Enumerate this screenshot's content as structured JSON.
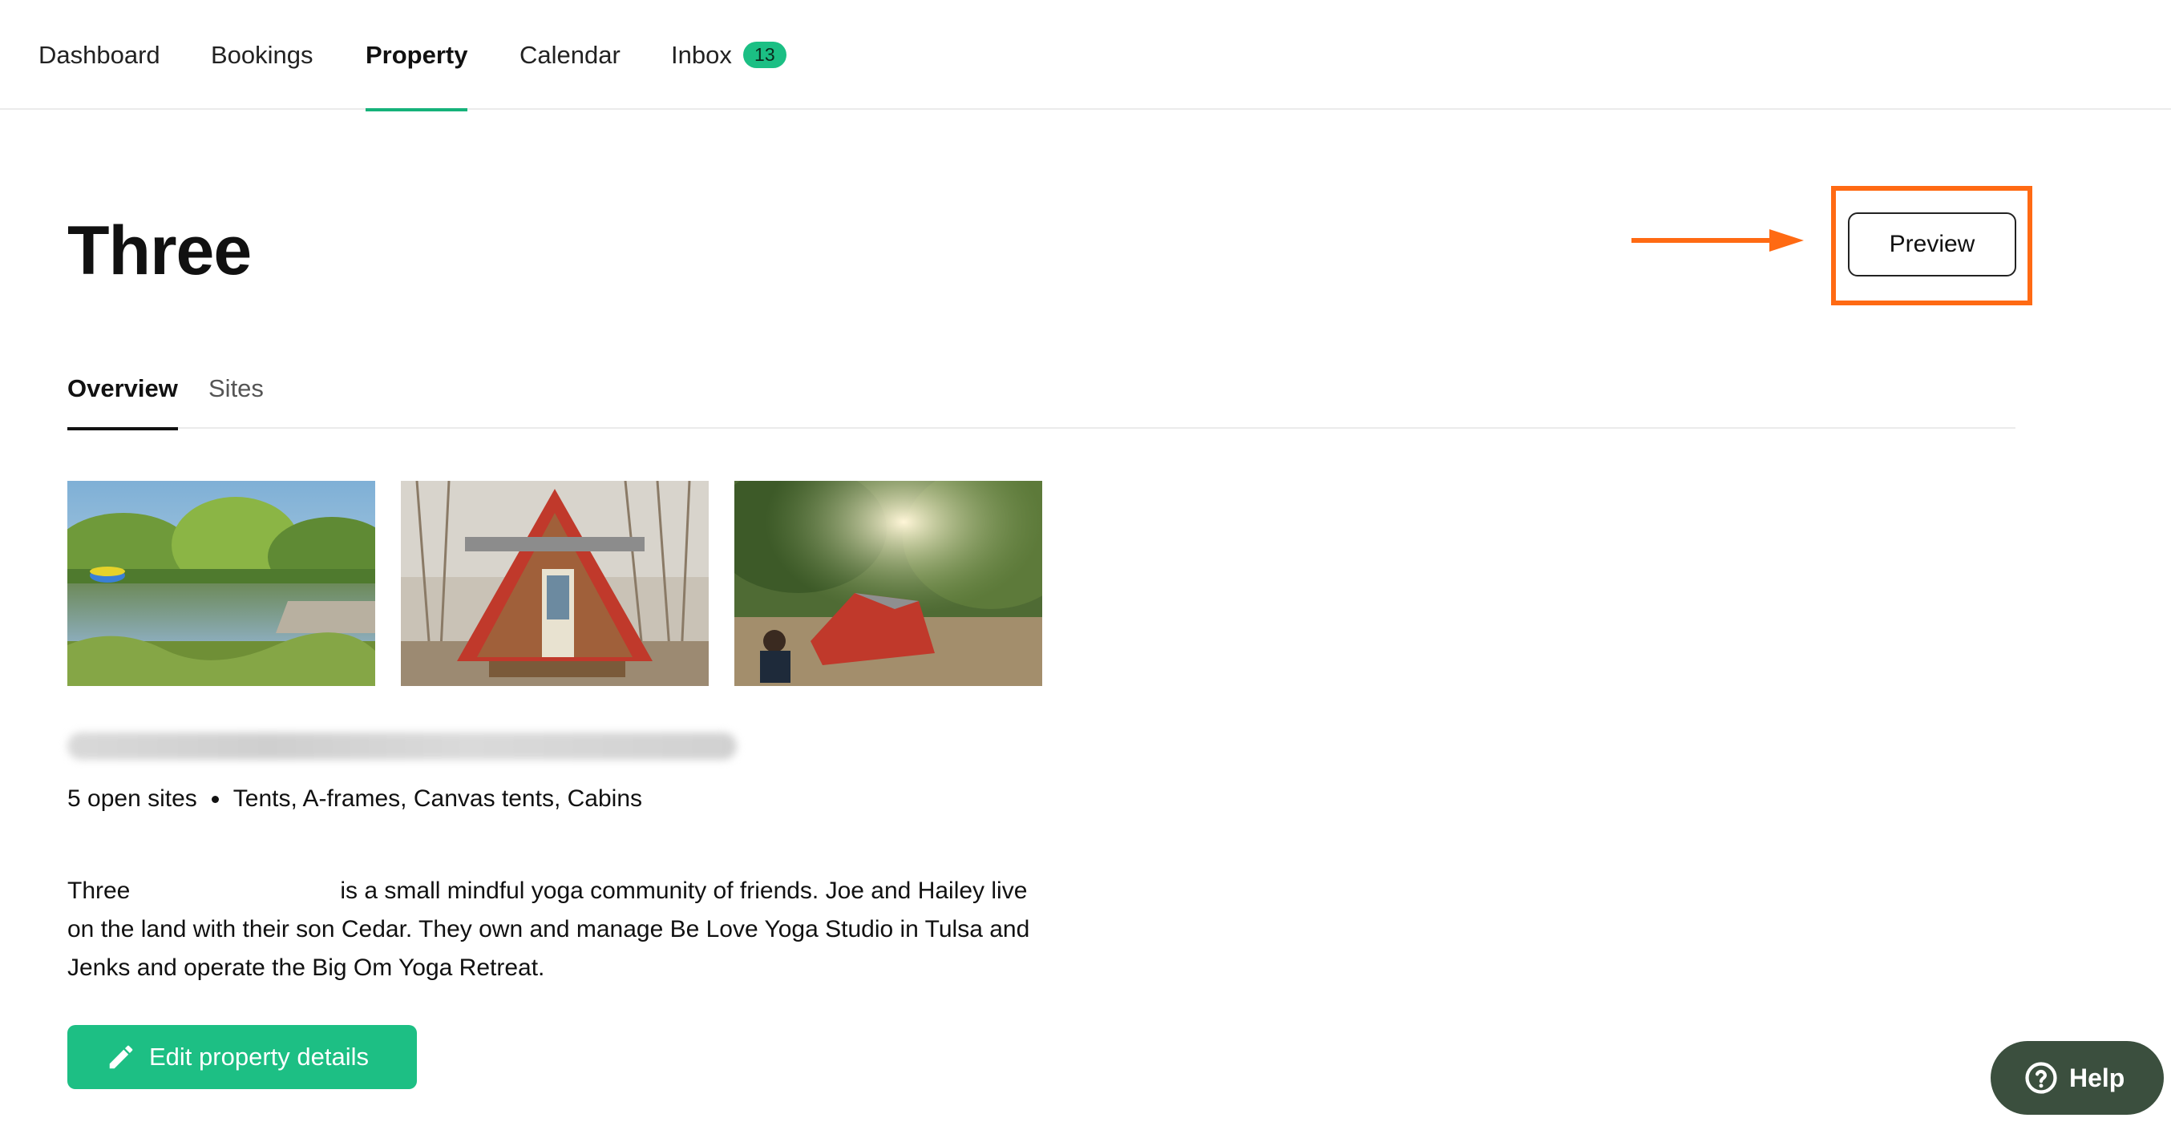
{
  "nav": {
    "items": [
      {
        "label": "Dashboard"
      },
      {
        "label": "Bookings"
      },
      {
        "label": "Property"
      },
      {
        "label": "Calendar"
      },
      {
        "label": "Inbox",
        "badge": "13"
      }
    ],
    "active": "Property"
  },
  "property": {
    "title": "Three",
    "preview_label": "Preview",
    "tabs": [
      {
        "label": "Overview"
      },
      {
        "label": "Sites"
      }
    ],
    "active_tab": "Overview",
    "summary": {
      "open_sites": "5 open sites",
      "site_types": "Tents, A-frames, Canvas tents, Cabins"
    },
    "description": {
      "lead": "Three",
      "rest": "is a small mindful yoga community of friends. Joe and Hailey live on the land with their son Cedar. They own and manage Be Love Yoga Studio in Tulsa and Jenks and operate the Big Om Yoga Retreat."
    },
    "edit_label": "Edit property details",
    "photos": [
      {
        "icon": "pond-photo"
      },
      {
        "icon": "a-frame-cabin-photo"
      },
      {
        "icon": "tent-camping-photo"
      }
    ]
  },
  "help": {
    "label": "Help"
  },
  "colors": {
    "accent": "#1dbf84",
    "highlight": "#ff6a13",
    "help_bg": "#3b4f3e"
  }
}
